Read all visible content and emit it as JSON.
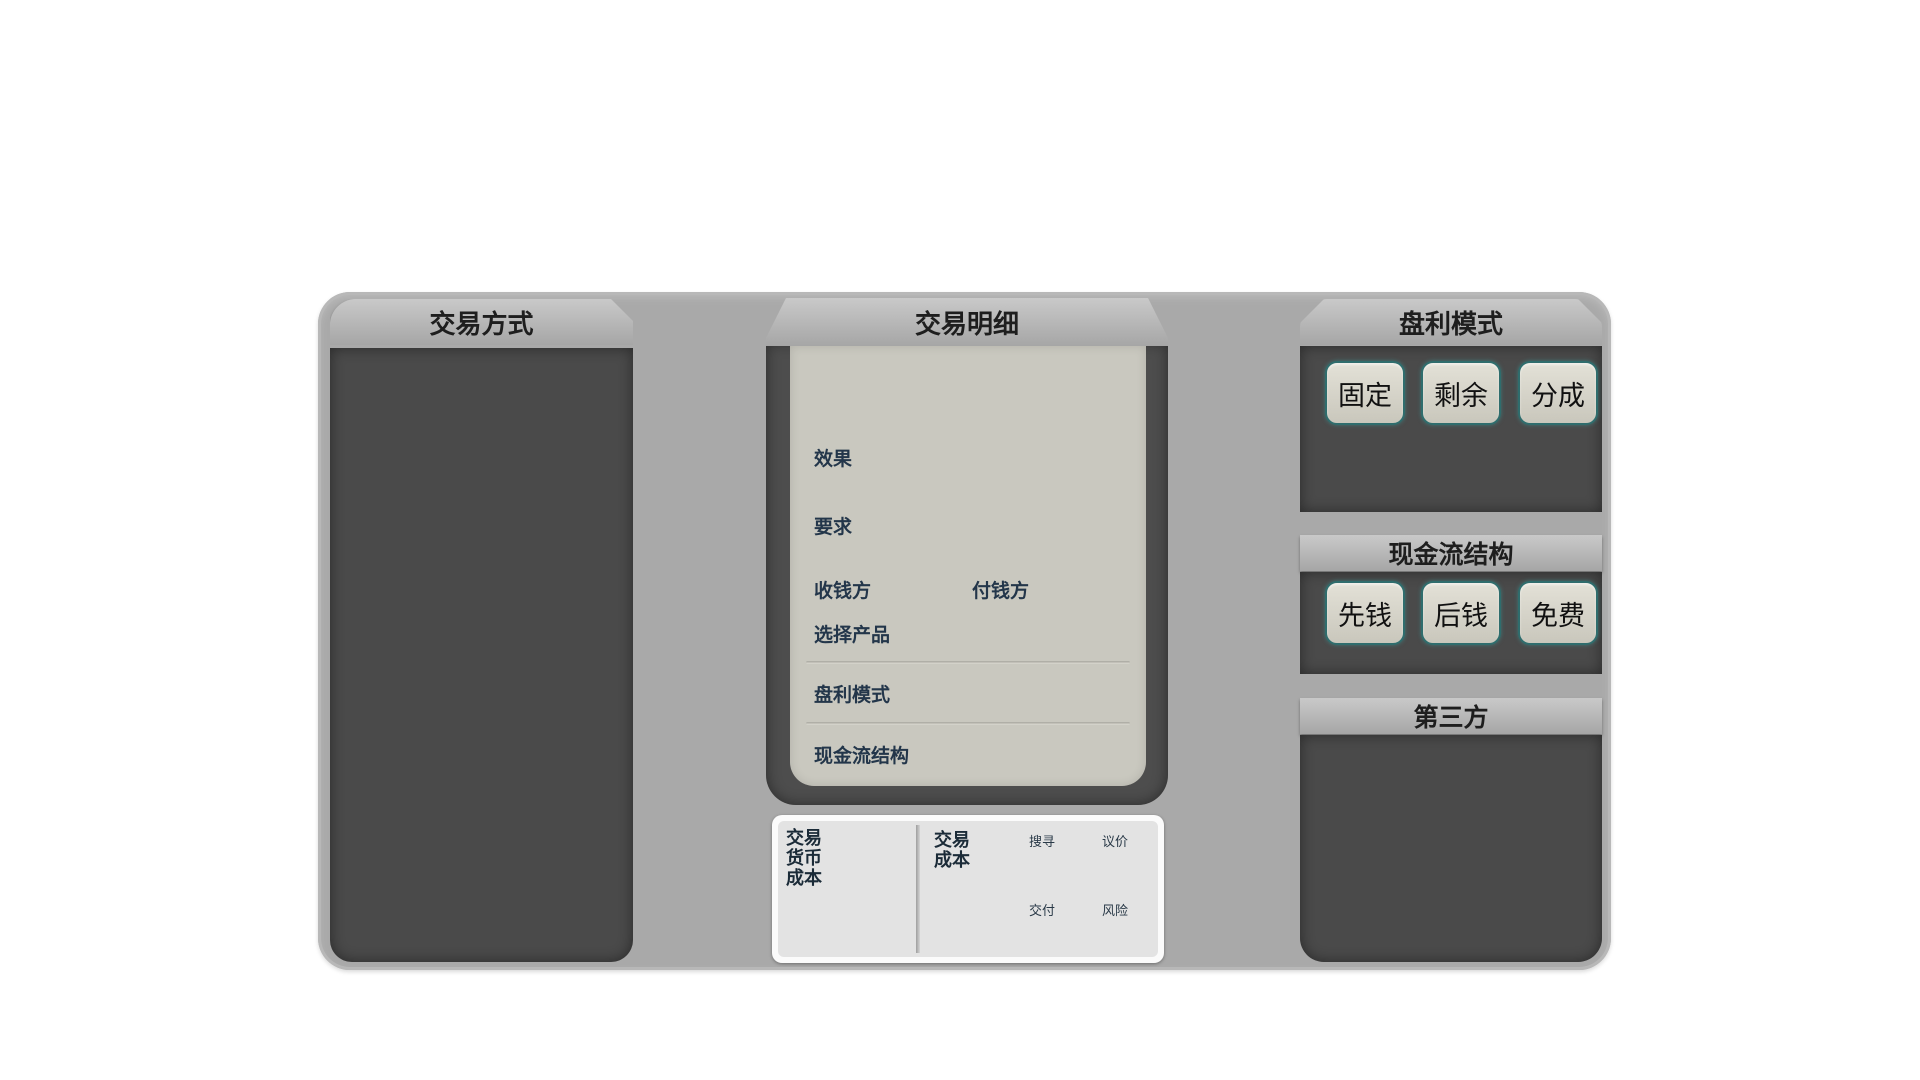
{
  "left": {
    "title": "交易方式"
  },
  "middle": {
    "title": "交易明细",
    "labels": {
      "effect": "效果",
      "requirement": "要求",
      "payee": "收钱方",
      "payer": "付钱方",
      "select_product": "选择产品",
      "profit_mode": "盘利模式",
      "cashflow": "现金流结构"
    }
  },
  "bottom": {
    "left_title": [
      "交易",
      "货币",
      "成本"
    ],
    "right_title": [
      "交易",
      "成本"
    ],
    "items": {
      "search": "搜寻",
      "negotiate": "议价",
      "deliver": "交付",
      "risk": "风险"
    }
  },
  "right": {
    "profit": {
      "title": "盘利模式",
      "buttons": [
        "固定",
        "剩余",
        "分成"
      ]
    },
    "cashflow": {
      "title": "现金流结构",
      "buttons": [
        "先钱",
        "后钱",
        "免费"
      ]
    },
    "third_party": {
      "title": "第三方"
    }
  },
  "colors": {
    "board": "#a9a9a9",
    "panel": "#4a4a4a",
    "paper": "#c9c8bf",
    "chip_border": "#2f6d6d",
    "label_text": "#23364a"
  }
}
